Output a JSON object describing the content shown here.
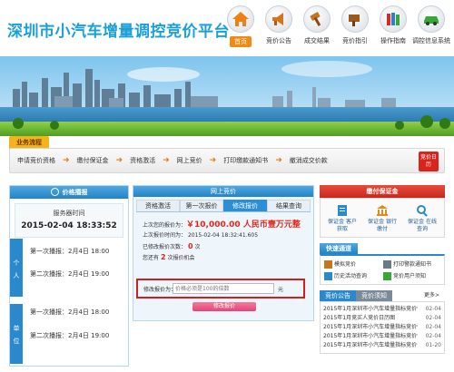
{
  "header": {
    "logo_text": "深圳市小汽车增量调控竞价平台",
    "nav": [
      {
        "label": "首页",
        "icon": "home-icon",
        "active": true
      },
      {
        "label": "竞价公告",
        "icon": "megaphone-icon",
        "active": false
      },
      {
        "label": "成交结果",
        "icon": "hammer-icon",
        "active": false
      },
      {
        "label": "竞价指引",
        "icon": "guide-book-icon",
        "active": false
      },
      {
        "label": "操作指南",
        "icon": "books-icon",
        "active": false
      },
      {
        "label": "调控信息系统",
        "icon": "car-icon",
        "active": false
      }
    ]
  },
  "process": {
    "title": "业务流程",
    "steps": [
      "申请竞价资格",
      "缴付保证金",
      "资格激活",
      "网上竞价",
      "打印缴款通知书",
      "撤消成交价款"
    ],
    "calendar_label": "竞价日历"
  },
  "left": {
    "title": "价格播报",
    "server_label": "服务器时间",
    "server_time": "2015-02-04 18:33:52",
    "tab_personal": "个人",
    "tab_unit": "单位",
    "broadcasts_personal": [
      "第一次播报：2月4日 18:00",
      "第二次播报：2月4日 19:00"
    ],
    "broadcasts_unit": [
      "第一次播报：2月4日 18:00",
      "第二次播报：2月4日 19:00"
    ]
  },
  "middle": {
    "title": "网上竞价",
    "tabs": [
      "资格激活",
      "第一次报价",
      "修改报价",
      "结果查询"
    ],
    "active_tab": 2,
    "last_bid_label": "上次您的报价为：",
    "last_bid_value": "￥10,000.00 人民币壹万元整",
    "last_bid_time_label": "上次报价时间为：",
    "last_bid_time": "2015-02-04 18:32:41.605",
    "modified_label": "已修改报价次数：",
    "modified_count": "0",
    "modified_unit": "次",
    "remaining_label": "您还有",
    "remaining_count": "2",
    "remaining_suffix": "次报价机会",
    "modify_input_label": "修改报价为：",
    "modify_input_placeholder": "价格必须是100的倍数",
    "modify_input_unit": "元",
    "modify_button": "修改报价"
  },
  "right": {
    "deposit_title": "缴付保证金",
    "deposit_steps": [
      {
        "label": "保证金 客户获取"
      },
      {
        "label": "保证金 银行缴付"
      },
      {
        "label": "保证金 在线查询"
      }
    ],
    "quick_title": "快速通道",
    "quick_links": [
      "模拟竞价",
      "打印警款通知书",
      "历史活动查询",
      "竞价用户须知"
    ],
    "notice_tabs": [
      "竞价公告",
      "竞价须知",
      "更多>"
    ],
    "notices": [
      {
        "title": "2015年1月深圳市小汽车增量指标竞价情况",
        "date": "02-04"
      },
      {
        "title": "2015年1月竞买人竞价日历图",
        "date": "02-04"
      },
      {
        "title": "2015年1月深圳市小汽车增量指标竞价情况",
        "date": "02-04"
      },
      {
        "title": "2015年1月深圳市小汽车增量指标竞价信息",
        "date": "02-04"
      },
      {
        "title": "2015年1月深圳市小汽车增量指标竞价公告",
        "date": "01-20"
      }
    ]
  }
}
